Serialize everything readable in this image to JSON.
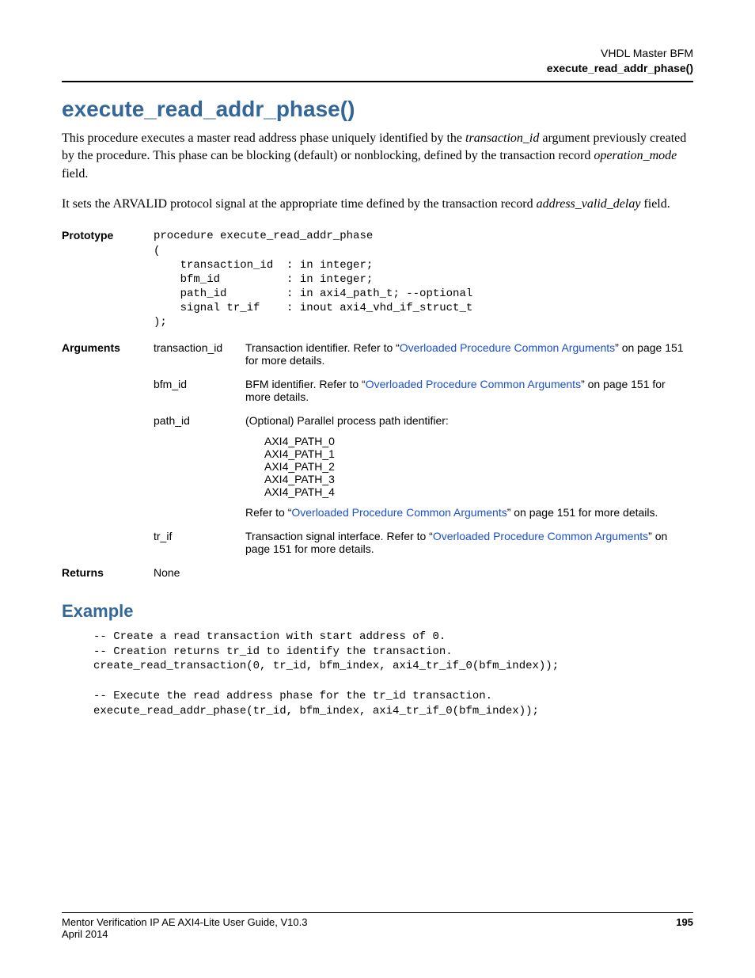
{
  "header": {
    "line1": "VHDL Master BFM",
    "line2": "execute_read_addr_phase()"
  },
  "title": "execute_read_addr_phase()",
  "intro": {
    "p1_prefix": "This procedure executes a master read address phase uniquely identified by the ",
    "p1_em1": "transaction_id",
    "p1_mid": " argument previously created by the  procedure. This phase can be blocking (default) or nonblocking, defined by the transaction record ",
    "p1_em2": "operation_mode",
    "p1_suffix": " field.",
    "p2_prefix": "It sets the ARVALID protocol signal at the appropriate time defined by the transaction record ",
    "p2_em1": "address_valid_delay",
    "p2_suffix": " field."
  },
  "labels": {
    "prototype": "Prototype",
    "arguments": "Arguments",
    "returns": "Returns"
  },
  "prototype_code": "procedure execute_read_addr_phase\n(\n    transaction_id  : in integer;\n    bfm_id          : in integer;\n    path_id         : in axi4_path_t; --optional\n    signal tr_if    : inout axi4_vhd_if_struct_t\n);",
  "args": {
    "transaction_id": {
      "name": "transaction_id",
      "pre": "Transaction identifier. Refer to “",
      "link": "Overloaded Procedure Common Arguments",
      "post": "” on page 151 for more details."
    },
    "bfm_id": {
      "name": "bfm_id",
      "pre": "BFM identifier. Refer to “",
      "link": "Overloaded Procedure Common Arguments",
      "post": "” on page 151 for more details."
    },
    "path_id": {
      "name": "path_id",
      "intro": "(Optional) Parallel process path identifier:",
      "p0": "AXI4_PATH_0",
      "p1": "AXI4_PATH_1",
      "p2": "AXI4_PATH_2",
      "p3": "AXI4_PATH_3",
      "p4": "AXI4_PATH_4",
      "refer_pre": "Refer to “",
      "refer_link": "Overloaded Procedure Common Arguments",
      "refer_post": "” on page 151 for more details."
    },
    "tr_if": {
      "name": "tr_if",
      "pre": "Transaction signal interface. Refer to “",
      "link": "Overloaded Procedure Common Arguments",
      "post": "” on page 151 for more details."
    }
  },
  "returns": "None",
  "example": {
    "heading": "Example",
    "code": "-- Create a read transaction with start address of 0.\n-- Creation returns tr_id to identify the transaction.\ncreate_read_transaction(0, tr_id, bfm_index, axi4_tr_if_0(bfm_index));\n\n-- Execute the read address phase for the tr_id transaction.\nexecute_read_addr_phase(tr_id, bfm_index, axi4_tr_if_0(bfm_index));"
  },
  "footer": {
    "left1": "Mentor Verification IP AE AXI4-Lite User Guide, V10.3",
    "left2": "April 2014",
    "page": "195"
  }
}
